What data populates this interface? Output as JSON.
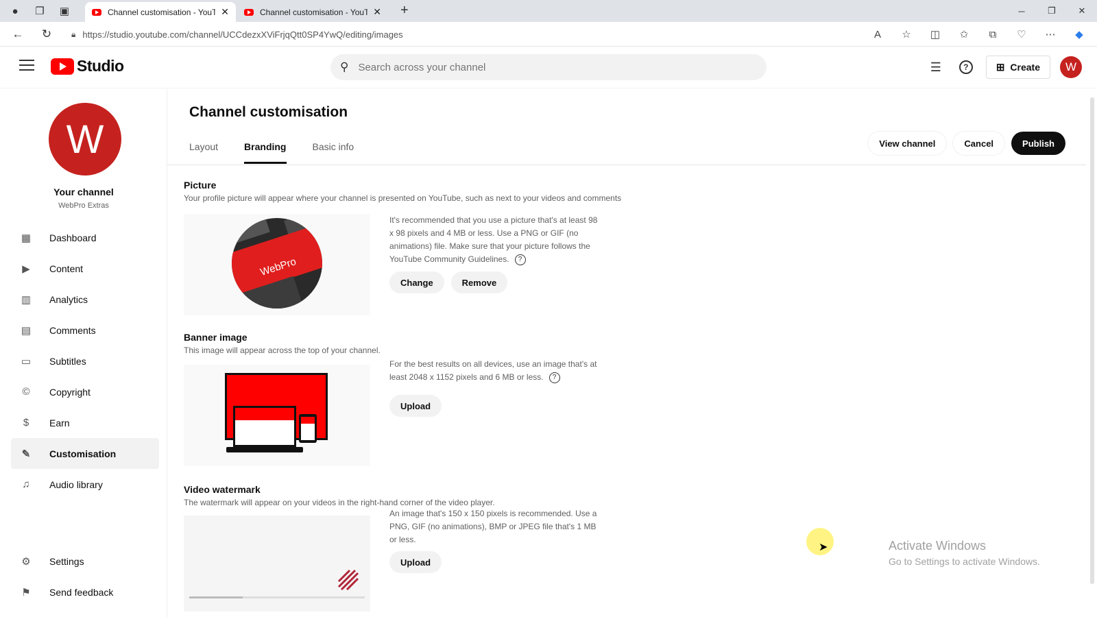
{
  "browser": {
    "tabs": [
      {
        "title": "Channel customisation - YouTube Studio",
        "active": true
      },
      {
        "title": "Channel customisation - YouTube Studio",
        "active": false
      }
    ],
    "url": "https://studio.youtube.com/channel/UCCdezxXViFrjqQtt0SP4YwQ/editing/images"
  },
  "header": {
    "logo_text": "Studio",
    "search_placeholder": "Search across your channel",
    "create_label": "Create",
    "avatar_letter": "W"
  },
  "sidebar": {
    "avatar_letter": "W",
    "channel_label": "Your channel",
    "channel_name": "WebPro Extras",
    "items": [
      {
        "label": "Dashboard",
        "icon": "dashboard-icon"
      },
      {
        "label": "Content",
        "icon": "content-icon"
      },
      {
        "label": "Analytics",
        "icon": "analytics-icon"
      },
      {
        "label": "Comments",
        "icon": "comments-icon"
      },
      {
        "label": "Subtitles",
        "icon": "subtitles-icon"
      },
      {
        "label": "Copyright",
        "icon": "copyright-icon"
      },
      {
        "label": "Earn",
        "icon": "earn-icon"
      },
      {
        "label": "Customisation",
        "icon": "customisation-icon",
        "selected": true
      },
      {
        "label": "Audio library",
        "icon": "audio-library-icon"
      }
    ],
    "bottom": [
      {
        "label": "Settings",
        "icon": "gear-icon"
      },
      {
        "label": "Send feedback",
        "icon": "feedback-icon"
      }
    ]
  },
  "main": {
    "title": "Channel customisation",
    "tabs": [
      "Layout",
      "Branding",
      "Basic info"
    ],
    "active_tab": "Branding",
    "actions": {
      "view": "View channel",
      "cancel": "Cancel",
      "publish": "Publish"
    },
    "picture": {
      "title": "Picture",
      "desc": "Your profile picture will appear where your channel is presented on YouTube, such as next to your videos and comments",
      "info": "It's recommended that you use a picture that's at least 98 x 98 pixels and 4 MB or less. Use a PNG or GIF (no animations) file. Make sure that your picture follows the YouTube Community Guidelines.",
      "image_text": "WebPro",
      "change": "Change",
      "remove": "Remove"
    },
    "banner": {
      "title": "Banner image",
      "desc": "This image will appear across the top of your channel.",
      "info": "For the best results on all devices, use an image that's at least 2048 x 1152 pixels and 6 MB or less.",
      "upload": "Upload"
    },
    "watermark": {
      "title": "Video watermark",
      "desc": "The watermark will appear on your videos in the right-hand corner of the video player.",
      "info": "An image that's 150 x 150 pixels is recommended. Use a PNG, GIF (no animations), BMP or JPEG file that's 1 MB or less.",
      "upload": "Upload"
    }
  },
  "os_overlay": {
    "line1": "Activate Windows",
    "line2": "Go to Settings to activate Windows."
  }
}
